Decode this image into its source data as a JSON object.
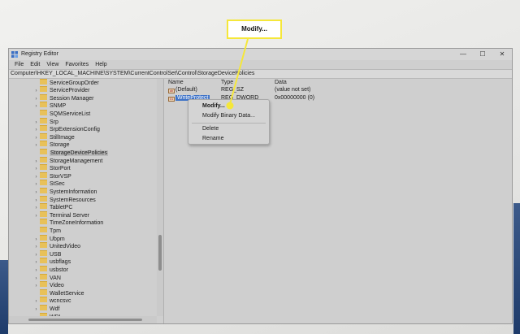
{
  "window": {
    "title": "Registry Editor",
    "controls": {
      "minimize": "—",
      "maximize": "☐",
      "close": "✕"
    }
  },
  "menu": [
    "File",
    "Edit",
    "View",
    "Favorites",
    "Help"
  ],
  "address": "Computer\\HKEY_LOCAL_MACHINE\\SYSTEM\\CurrentControlSet\\Control\\StorageDevicePolicies",
  "tree": [
    {
      "label": "ServiceGroupOrder",
      "expander": false
    },
    {
      "label": "ServiceProvider",
      "expander": true
    },
    {
      "label": "Session Manager",
      "expander": true
    },
    {
      "label": "SNMP",
      "expander": true
    },
    {
      "label": "SQMServiceList",
      "expander": false
    },
    {
      "label": "Srp",
      "expander": true
    },
    {
      "label": "SrpExtensionConfig",
      "expander": true
    },
    {
      "label": "StillImage",
      "expander": true
    },
    {
      "label": "Storage",
      "expander": true
    },
    {
      "label": "StorageDevicePolicies",
      "expander": false,
      "selected": true
    },
    {
      "label": "StorageManagement",
      "expander": true
    },
    {
      "label": "StorPort",
      "expander": true
    },
    {
      "label": "StorVSP",
      "expander": true
    },
    {
      "label": "StSec",
      "expander": true
    },
    {
      "label": "SystemInformation",
      "expander": true
    },
    {
      "label": "SystemResources",
      "expander": true
    },
    {
      "label": "TabletPC",
      "expander": true
    },
    {
      "label": "Terminal Server",
      "expander": true
    },
    {
      "label": "TimeZoneInformation",
      "expander": false
    },
    {
      "label": "Tpm",
      "expander": false
    },
    {
      "label": "Ubpm",
      "expander": true
    },
    {
      "label": "UnitedVideo",
      "expander": true
    },
    {
      "label": "USB",
      "expander": true
    },
    {
      "label": "usbflags",
      "expander": true
    },
    {
      "label": "usbstor",
      "expander": true
    },
    {
      "label": "VAN",
      "expander": true
    },
    {
      "label": "Video",
      "expander": true
    },
    {
      "label": "WalletService",
      "expander": false
    },
    {
      "label": "wcncsvc",
      "expander": true
    },
    {
      "label": "Wdf",
      "expander": true
    },
    {
      "label": "WDI",
      "expander": true
    }
  ],
  "list": {
    "headers": {
      "name": "Name",
      "type": "Type",
      "data": "Data"
    },
    "rows": [
      {
        "icon": "ab",
        "name": "(Default)",
        "type": "REG_SZ",
        "data": "(value not set)",
        "selected": false
      },
      {
        "icon": "01",
        "name": "WriteProtect",
        "type": "REG_DWORD",
        "data": "0x00000000 (0)",
        "selected": true
      }
    ]
  },
  "context_menu": {
    "modify": "Modify...",
    "modify_binary": "Modify Binary Data...",
    "delete": "Delete",
    "rename": "Rename"
  },
  "callout": {
    "text": "Modify...",
    "border_color": "#f5e73a",
    "dot_color": "#f5e73a"
  }
}
